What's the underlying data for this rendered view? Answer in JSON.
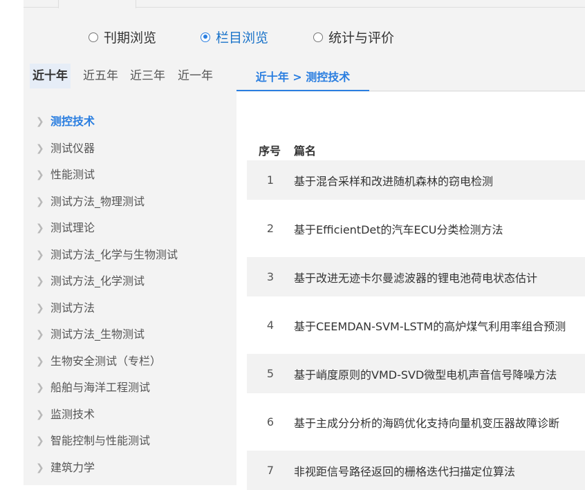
{
  "browse_modes": [
    {
      "label": "刊期浏览",
      "checked": false
    },
    {
      "label": "栏目浏览",
      "checked": true
    },
    {
      "label": "统计与评价",
      "checked": false
    }
  ],
  "year_tabs": [
    {
      "label": "近十年",
      "active": true
    },
    {
      "label": "近五年",
      "active": false
    },
    {
      "label": "近三年",
      "active": false
    },
    {
      "label": "近一年",
      "active": false
    }
  ],
  "breadcrumb": "近十年 > 测控技术",
  "sidebar": {
    "items": [
      {
        "label": "测控技术",
        "active": true
      },
      {
        "label": "测试仪器",
        "active": false
      },
      {
        "label": "性能测试",
        "active": false
      },
      {
        "label": "测试方法_物理测试",
        "active": false
      },
      {
        "label": "测试理论",
        "active": false
      },
      {
        "label": "测试方法_化学与生物测试",
        "active": false
      },
      {
        "label": "测试方法_化学测试",
        "active": false
      },
      {
        "label": "测试方法",
        "active": false
      },
      {
        "label": "测试方法_生物测试",
        "active": false
      },
      {
        "label": "生物安全测试（专栏）",
        "active": false
      },
      {
        "label": "船舶与海洋工程测试",
        "active": false
      },
      {
        "label": "监测技术",
        "active": false
      },
      {
        "label": "智能控制与性能测试",
        "active": false
      },
      {
        "label": "建筑力学",
        "active": false
      }
    ]
  },
  "table": {
    "headers": {
      "seq": "序号",
      "title": "篇名"
    },
    "rows": [
      {
        "seq": "1",
        "title": "基于混合采样和改进随机森林的窃电检测"
      },
      {
        "seq": "2",
        "title": "基于EfficientDet的汽车ECU分类检测方法"
      },
      {
        "seq": "3",
        "title": "基于改进无迹卡尔曼滤波器的锂电池荷电状态估计"
      },
      {
        "seq": "4",
        "title": "基于CEEMDAN-SVM-LSTM的高炉煤气利用率组合预测"
      },
      {
        "seq": "5",
        "title": "基于峭度原则的VMD-SVD微型电机声音信号降噪方法"
      },
      {
        "seq": "6",
        "title": "基于主成分分析的海鸥优化支持向量机变压器故障诊断"
      },
      {
        "seq": "7",
        "title": "非视距信号路径返回的栅格迭代扫描定位算法"
      }
    ]
  },
  "colors": {
    "accent": "#2a7ee0",
    "panel_bg": "#f3f3f3",
    "row_shade": "#f2f2f2"
  }
}
